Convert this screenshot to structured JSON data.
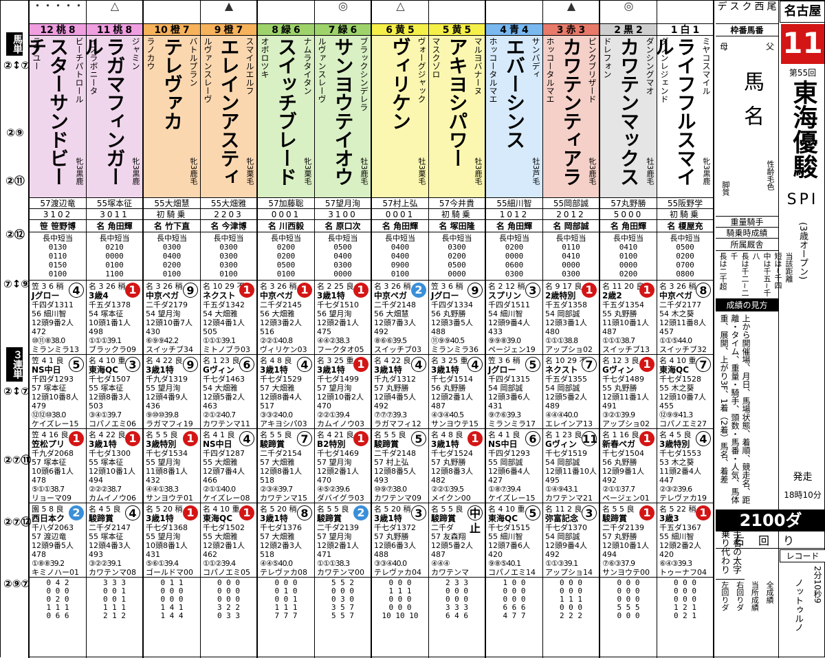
{
  "side_labels": {
    "umatan": "馬単",
    "sanrentan": "３連単",
    "combos_a": [
      "②↕⑦",
      "②⑨",
      "②⑪",
      "②⑫",
      "⑦↕⑨"
    ],
    "combos_b": [
      "②↕⑦",
      "②⑦⑪",
      "②⑦⑫",
      "②⑨⑦"
    ]
  },
  "race": {
    "venue": "名古屋",
    "number": "11",
    "edition": "第55回",
    "title": "東海優駿",
    "grade": "SPI",
    "cond": "(3歳オープン)",
    "start_label": "発走",
    "start_time": "18時10分",
    "distance": "2100ダ",
    "direction": "右回り",
    "record_label": "レコード",
    "record_time": "2分10秒9",
    "record_horse": "ノットゥルノ",
    "news": [
      "デ",
      "ス",
      "ク",
      "西",
      "尾"
    ]
  },
  "legend": {
    "rows": [
      "枠番馬番",
      "父",
      "母",
      "馬名",
      "性齢毛色",
      "脚質",
      "重量騎手",
      "騎乗時成績",
      "所属厩舎",
      "当該距離",
      "短は~千四",
      "中は千五~千八",
      "長は千二~二千",
      "長は二千超",
      "成績の見方",
      "上から開催場、月日、馬場状態、着順、競走名、距離・タイム、重量・騎手、頭数・馬番・人気、馬体重、展開、上がり3F、1着（2着）馬名、着差",
      "騎手名の太字は乗り代わり",
      "全成績",
      "当所成績",
      "右回りダ",
      "左回りダ"
    ]
  },
  "horses": [
    {
      "num": "12",
      "frame": "8",
      "color": "桃",
      "mark": "・・・・・",
      "sire": "ビーチパトロール",
      "horse": "スターサンドビーチ",
      "dam": "ラブユー",
      "sex": "牝3黒鹿",
      "jockey": "57渡辺竜",
      "rec": "3102",
      "trainer": "笹 笹野博",
      "dist": "長中短当\n0130\n0110\n0150\n0100",
      "r1": {
        "hd": "笠 3 6 稍",
        "pos": "4",
        "name": "Jグロー",
        "time": "千四ダ1311",
        "jk": "56 細川智",
        "hn": "12頭9番2人472",
        "pass": "⑩⑪⑧38.0",
        "win": "ミランミラ13"
      },
      "r2": {
        "hd": "笠 4 1 良",
        "pos": "5",
        "name": "NS中日",
        "time": "千四ダ1293",
        "jk": "57 塚本征",
        "hn": "12頭10番8人479",
        "pass": "⑫⑫⑩38.0",
        "win": "ケイズレー15"
      },
      "r3": {
        "hd": "笠 4 16 良",
        "pos": "1",
        "name": "笠松プリ",
        "time": "千九ダ2068",
        "jk": "57 塚本征",
        "hn": "10頭6番1人478",
        "pass": "⑤①①38.7",
        "win": "リョーマ09"
      },
      "r4": {
        "hd": "園 5 8 良",
        "pos": "2",
        "name": "西日本ク",
        "time": "千八ダ2063",
        "jk": "57 渡辺竜",
        "hn": "12頭9番5人478",
        "pass": "①⑧⑧39.2",
        "win": "キミノハー01"
      },
      "foot": "0 4 2\n0 0 0\n0 2 0\n1 1 1\n0 6 6"
    },
    {
      "num": "11",
      "frame": "8",
      "color": "桃",
      "mark": "△",
      "sire": "ジャミン",
      "horse": "ラガマフィンガール",
      "dam": "イスラボニータ",
      "sex": "牝3黒鹿",
      "jockey": "55塚本征",
      "rec": "3011",
      "trainer": "名 角田輝",
      "dist": "長中短当\n0210\n0000\n0100\n1100",
      "r1": {
        "hd": "名 3 26 稍",
        "pos": "1",
        "name": "3歳4",
        "time": "千五ダ1378",
        "jk": "54 塚本征",
        "hn": "10頭1番1人498",
        "pass": "①①①39.1",
        "win": "ブラックラ09"
      },
      "r2": {
        "hd": "名 4 10 重",
        "pos": "3",
        "name": "東海QC",
        "time": "千七ダ1507",
        "jk": "55 塚本征",
        "hn": "12頭8番3人503",
        "pass": "③④①39.7",
        "win": "コパノエミ06"
      },
      "r3": {
        "hd": "名 4 22 良",
        "pos": "1",
        "name": "3歳1特",
        "time": "千七ダ1300",
        "jk": "55 塚本征",
        "hn": "12頭10番1人494",
        "pass": "②②②38.7",
        "win": "カムイノウ06"
      },
      "r4": {
        "hd": "名 4 5 良",
        "pos": "4",
        "name": "駿蹄賞",
        "time": "二千ダ2147",
        "jk": "55 塚本征",
        "hn": "12頭4番3人493",
        "pass": "③②②39.1",
        "win": "カワテンマ08"
      },
      "foot": "3 3 3\n0 0 1\n0 0 1\n1 1 1\n2 1 2"
    },
    {
      "num": "10",
      "frame": "7",
      "color": "橙",
      "mark": "",
      "sire": "バトルプラン",
      "horse": "テレヴァカ",
      "dam": "ラノカウ",
      "sex": "牝3鹿毛",
      "jockey": "55大畑慧",
      "rec": "初騎乗",
      "trainer": "名 竹下直",
      "dist": "長中短当\n0300\n0400\n0200\n0100",
      "r1": {
        "hd": "名 3 26 稍",
        "pos": "9",
        "name": "中京ペガ",
        "time": "二千ダ2179",
        "jk": "54 望月洵",
        "hn": "12頭10番7人430",
        "pass": "⑥⑨⑨42.2",
        "win": "スイッチブ34"
      },
      "r2": {
        "hd": "名 4 22 良",
        "pos": "9",
        "name": "3歳1特",
        "time": "千九ダ1319",
        "jk": "55 望月洵",
        "hn": "12頭4番9人436",
        "pass": "⑨⑩⑩39.8",
        "win": "ラガマフィ19"
      },
      "r3": {
        "hd": "名 5 5 良",
        "pos": "1",
        "name": "3歳特別",
        "time": "千七ダ1534",
        "jk": "55 望月洵",
        "hn": "11頭8番1人432",
        "pass": "④④①38.3",
        "win": "サンヨウテ01"
      },
      "r4": {
        "hd": "名 5 20 稍",
        "pos": "1",
        "name": "3歳1特",
        "time": "千七ダ1368",
        "jk": "55 望月洵",
        "hn": "10頭8番1人431",
        "pass": "⑤⑥①39.4",
        "win": "ゴールドマ00"
      },
      "foot": "0 1 1\n0 0 0\n0 0 0\n1 4 1\n1 4 4"
    },
    {
      "num": "9",
      "frame": "7",
      "color": "橙",
      "mark": "▲",
      "sire": "スマイルエルフ",
      "horse": "エレインアスティ",
      "dam": "ルヴァンスレーヴ",
      "sex": "牝3栗毛",
      "jockey": "55大畑雅",
      "rec": "2203",
      "trainer": "名 今津博",
      "dist": "長中短当\n0300\n0300\n0300\n0100",
      "r1": {
        "hd": "名 10 29 不",
        "pos": "1",
        "name": "ネクスト",
        "time": "千五ダ1342",
        "jk": "54 大畑雅",
        "hn": "12頭4番1人505",
        "pass": "①①①39.1",
        "win": "ミトノブラ03"
      },
      "r2": {
        "hd": "名 1 23 良",
        "pos": "6",
        "name": "Gヴィン",
        "time": "千七ダ1463",
        "jk": "54 大畑雅",
        "hn": "12頭5番2人463",
        "pass": "②①②40.7",
        "win": "カワテンマ11"
      },
      "r3": {
        "hd": "名 4 1 良",
        "pos": "4",
        "name": "NS中日",
        "time": "千四ダ1287",
        "jk": "55 大畑雅",
        "hn": "12頭7番4人466",
        "pass": "②①①40.0",
        "win": "ケイズレー08"
      },
      "r4": {
        "hd": "名 4 10 重",
        "pos": "1",
        "name": "東海QC",
        "time": "千七ダ1502",
        "jk": "55 大畑雅",
        "hn": "12頭2番1人462",
        "pass": "①①②39.4",
        "win": "コパノエミ05"
      },
      "foot": "0 0 0\n0 0 0\n0 0 0\n3 2 2\n0 3 3"
    },
    {
      "num": "8",
      "frame": "6",
      "color": "緑",
      "mark": "",
      "sire": "ナムラタイタン",
      "horse": "スイッチブレード",
      "dam": "オボロツキ",
      "sex": "牝3栗毛",
      "jockey": "57加藤聡",
      "rec": "0001",
      "trainer": "名 川西毅",
      "dist": "長中短当\n0200\n0200\n0500\n0100",
      "r1": {
        "hd": "名 3 26 稍",
        "pos": "1",
        "name": "中京ペガ",
        "time": "二千ダ2145",
        "jk": "56 大畑雅",
        "hn": "12頭3番2人516",
        "pass": "②②①40.8",
        "win": "ヴィリケン03"
      },
      "r2": {
        "hd": "名 4 8 良",
        "pos": "4",
        "name": "3歳1特",
        "time": "千七ダ1529",
        "jk": "57 大畑雅",
        "hn": "12頭8番4人517",
        "pass": "③③②40.0",
        "win": "アキヨシパ03"
      },
      "r3": {
        "hd": "名 5 5 良",
        "pos": "7",
        "name": "駿蹄賞",
        "time": "二千ダ2154",
        "jk": "57 大畑雅",
        "hn": "12頭8番1人518",
        "pass": "②③④39.7",
        "win": "カワテンマ15"
      },
      "r4": {
        "hd": "名 5 20 稍",
        "pos": "8",
        "name": "3歳1特",
        "time": "千七ダ1376",
        "jk": "57 大畑雅",
        "hn": "12頭2番3人518",
        "pass": "④④⑤40.0",
        "win": "テレヴァカ08"
      },
      "foot": "0 0 0\n0 1 0\n0 0 1\n1 1 1\n7 7 7"
    },
    {
      "num": "7",
      "frame": "6",
      "color": "緑",
      "mark": "◎",
      "sire": "ブラックシンデレラ",
      "horse": "サンヨウテイオウ",
      "dam": "ルヴァンスレーヴ",
      "sex": "牡3鹿毛",
      "jockey": "57望月洵",
      "rec": "3100",
      "trainer": "名 原口次",
      "dist": "長中短当\n0500\n0400\n0300\n0000",
      "r1": {
        "hd": "名 2 25 良",
        "pos": "1",
        "name": "3歳1特",
        "time": "千七ダ1510",
        "jk": "56 望月洵",
        "hn": "12頭2番1人475",
        "pass": "④④②38.3",
        "win": "フークタオ05"
      },
      "r2": {
        "hd": "名 3 25 重",
        "pos": "1",
        "name": "3歳1特",
        "time": "千七ダ1499",
        "jk": "57 望月洵",
        "hn": "12頭10番2人470",
        "pass": "②②①39.4",
        "win": "カムイノウ03"
      },
      "r3": {
        "hd": "名 4 21 良",
        "pos": "1",
        "name": "B2特別",
        "time": "千七ダ1469",
        "jk": "57 望月洵",
        "hn": "12頭2番1人470",
        "pass": "④⑤②39.6",
        "win": "ダバイグラ03"
      },
      "r4": {
        "hd": "名 5 5 良",
        "pos": "2",
        "name": "駿蹄賞",
        "time": "二千ダ2139",
        "jk": "57 望月洵",
        "hn": "12頭2番1人471",
        "pass": "①①①38.3",
        "win": "カワテンマ00"
      },
      "foot": "5 5 2\n0 0 0\n0 3 0\n3 5 7\n5 5 7"
    },
    {
      "num": "6",
      "frame": "5",
      "color": "黄",
      "mark": "△",
      "sire": "ヴォーグジャック",
      "horse": "ヴィリケン",
      "dam": "",
      "sex": "牡3栗毛",
      "jockey": "57村上弘",
      "rec": "0001",
      "trainer": "名 角田輝",
      "dist": "長中短当\n0400\n0400\n0900\n0100",
      "r1": {
        "hd": "名 3 26 稍",
        "pos": "2",
        "name": "中京ペガ",
        "time": "二千ダ2148",
        "jk": "56 大畑慧",
        "hn": "12頭7番3人492",
        "pass": "⑧⑥⑥39.5",
        "win": "スイッチブ03"
      },
      "r2": {
        "hd": "名 4 22 良",
        "pos": "4",
        "name": "3歳1特",
        "time": "千九ダ1312",
        "jk": "57 丸野勝",
        "hn": "12頭4番5人492",
        "pass": "⑦⑦⑦39.3",
        "win": "ラガマフィ12"
      },
      "r3": {
        "hd": "名 5 5 良",
        "pos": "5",
        "name": "駿蹄賞",
        "time": "二千ダ2148",
        "jk": "57 村上弘",
        "hn": "12頭8番5人493",
        "pass": "⑩⑨⑦38.0",
        "win": "カワテンマ09"
      },
      "r4": {
        "hd": "名 5 20 稍",
        "pos": "3",
        "name": "3歳1特",
        "time": "千七ダ1372",
        "jk": "57 丸野勝",
        "hn": "12頭6番3人488",
        "pass": "③③④40.0",
        "win": "テレヴァカ04"
      },
      "foot": "0 0 0\n1 1 1\n0 0 0\n0 0 0\n10 10 10"
    },
    {
      "num": "5",
      "frame": "5",
      "color": "黄",
      "mark": "",
      "sire": "マルヨバナーヌ",
      "horse": "アキヨシパワー",
      "dam": "マスクゾロ",
      "sex": "牡3鹿毛",
      "jockey": "57今井貴",
      "rec": "初騎乗",
      "trainer": "名 塚田隆",
      "dist": "長中短当\n0300\n0200\n0500\n0000",
      "r1": {
        "hd": "笠 3 6 稍",
        "pos": "9",
        "name": "Jグロー",
        "time": "千四ダ1334",
        "jk": "56 丸野勝",
        "hn": "12頭3番5人488",
        "pass": "⑪⑨⑨40.5",
        "win": "ミランミラ36"
      },
      "r2": {
        "hd": "名 3 25 重",
        "pos": "4",
        "name": "3歳1特",
        "time": "千七ダ1514",
        "jk": "56 丸野勝",
        "hn": "12頭2番1人487",
        "pass": "④③④40.5",
        "win": "サンヨウテ15"
      },
      "r3": {
        "hd": "名 4 8 良",
        "pos": "1",
        "name": "3歳1特",
        "time": "千七ダ1524",
        "jk": "57 丸野勝",
        "hn": "12頭8番3人482",
        "pass": "②②①39.5",
        "win": "メイクン00"
      },
      "r4": {
        "hd": "名 5 5 良",
        "pos": "中止",
        "name": "駿蹄賞",
        "time": "二千ダ",
        "jk": "57 友森翔",
        "hn": "12頭5番2人487",
        "pass": "④④④",
        "win": "カワテンマ"
      },
      "foot": "2 3 3\n0 0 0\n0 0 0\n3 3 3\n6 4 6"
    },
    {
      "num": "4",
      "frame": "4",
      "color": "青",
      "mark": "",
      "sire": "サンバディ",
      "horse": "エバーシンス",
      "dam": "ホッコータルマエ",
      "sex": "牡3芦毛",
      "jockey": "55細川智",
      "rec": "1012",
      "trainer": "名 角田輝",
      "dist": "長中短当\n0200\n0000\n0600\n0300",
      "r1": {
        "hd": "名 2 12 稍",
        "pos": "3",
        "name": "スプリン",
        "time": "千四ダ1511",
        "jk": "54 細川智",
        "hn": "12頭9番4人433",
        "pass": "⑨⑨⑧39.0",
        "win": "ページェン19"
      },
      "r2": {
        "hd": "笠 3 6 稍",
        "pos": "5",
        "name": "Jグロー",
        "time": "千四ダ1315",
        "jk": "54 岡部誠",
        "hn": "12頭3番6人431",
        "pass": "⑨⑦⑥39.3",
        "win": "ミランミラ17"
      },
      "r3": {
        "hd": "名 4 1 良",
        "pos": "6",
        "name": "NS中日",
        "time": "千四ダ1293",
        "jk": "55 岡部誠",
        "hn": "12頭6番4人427",
        "pass": "①⑧⑦39.4",
        "win": "ケイズレー15"
      },
      "r4": {
        "hd": "名 4 10 重",
        "pos": "5",
        "name": "東海QC",
        "time": "千七ダ1515",
        "jk": "55 細川智",
        "hn": "12頭7番6人420",
        "pass": "⑨⑧⑤40.1",
        "win": "コパノエミ14"
      },
      "foot": "1 0 0\n0 0 0\n0 0 0\n6 6 6\n4 7 7"
    },
    {
      "num": "3",
      "frame": "3",
      "color": "赤",
      "mark": "▲",
      "sire": "ピンクブリザード",
      "horse": "カワテンティアラ",
      "dam": "ホッコータルマエ",
      "sex": "牝3鹿毛",
      "jockey": "55岡部誠",
      "rec": "2012",
      "trainer": "名 岡部誠",
      "dist": "長中短当\n0110\n0410\n0000\n0300",
      "r1": {
        "hd": "名 9 17 良",
        "pos": "1",
        "name": "2歳特別",
        "time": "千五ダ1358",
        "jk": "54 岡部誠",
        "hn": "12頭3番1人480",
        "pass": "①①①38.8",
        "win": "アップショ02"
      },
      "r2": {
        "hd": "名 10 29 不",
        "pos": "7",
        "name": "ネクスト",
        "time": "千五ダ1355",
        "jk": "54 岡部誠",
        "hn": "12頭5番2人489",
        "pass": "④④④40.0",
        "win": "エレインア13"
      },
      "r3": {
        "hd": "名 1 23 良",
        "pos": "11",
        "name": "Gヴィン",
        "time": "千七ダ1519",
        "jk": "54 岡部誠",
        "hn": "12頭11番10人495",
        "pass": "①④⑨43.1",
        "win": "カワテンマ21"
      },
      "r4": {
        "hd": "名 11 2 良",
        "pos": "3",
        "name": "弥富記念",
        "time": "千七ダ1370",
        "jk": "54 岡部誠",
        "hn": "12頭9番4人492",
        "pass": "①①③39.1",
        "win": "アップショ14"
      },
      "foot": "0 0 0\n0 0 0\n1 1 1\n0 0 0\n2 2 2"
    },
    {
      "num": "2",
      "frame": "2",
      "color": "黒",
      "mark": "◎",
      "sire": "ダンシングマオ",
      "horse": "カワテンマックス",
      "dam": "ドレフォン",
      "sex": "牡3鹿毛",
      "jockey": "57丸野勝",
      "rec": "5000",
      "trainer": "名 角田輝",
      "dist": "長中短当\n0410\n0100\n0000\n0200",
      "r1": {
        "hd": "名 11 20 良",
        "pos": "1",
        "name": "2歳2",
        "time": "千五ダ1354",
        "jk": "55 丸野勝",
        "hn": "11頭10番1人487",
        "pass": "①①①38.7",
        "win": "スイッチブ13"
      },
      "r2": {
        "hd": "名 12 3 良",
        "pos": "1",
        "name": "Gヴィン",
        "time": "千七ダ1489",
        "jk": "55 丸野勝",
        "hn": "12頭11番1人491",
        "pass": "③②①39.9",
        "win": "アップショ02"
      },
      "r3": {
        "hd": "名 1 16 良",
        "pos": "1",
        "name": "新春ペガ",
        "time": "千七ダ1504",
        "jk": "56 丸野勝",
        "hn": "12頭9番1人492",
        "pass": "②①①37.7",
        "win": "ページェン01"
      },
      "r4": {
        "hd": "名 5 5 良",
        "pos": "1",
        "name": "駿蹄賞",
        "time": "二千ダ2139",
        "jk": "57 丸野勝",
        "hn": "12頭10番1人494",
        "pass": "⑦⑥③37.9",
        "win": "サンヨウテ00"
      },
      "foot": "0 0 0\n0 0 0\n0 0 0\n5 5 5\n0 0 0"
    },
    {
      "num": "1",
      "frame": "1",
      "color": "白",
      "mark": "",
      "sire": "ミヤコスマイル",
      "horse": "ライフフルスマイル",
      "dam": "ダノンレジェンド",
      "sex": "牝3黒鹿",
      "jockey": "55阪野学",
      "rec": "初騎乗",
      "trainer": "名 榎屋充",
      "dist": "長中短当\n0500\n0200\n0700\n0800",
      "r1": {
        "hd": "名 3 26 稍",
        "pos": "8",
        "name": "中京ペガ",
        "time": "二千ダ2177",
        "jk": "54 木之葵",
        "hn": "12頭11番8人457",
        "pass": "①①⑤44.0",
        "win": "スイッチブ32"
      },
      "r2": {
        "hd": "名 4 10 重",
        "pos": "7",
        "name": "東海QC",
        "time": "千七ダ1528",
        "jk": "55 木之葵",
        "hn": "12頭10番7人455",
        "pass": "⑫⑨⑨41.3",
        "win": "コパノエミ27"
      },
      "r3": {
        "hd": "名 4 5 良",
        "pos": "4",
        "name": "3歳特別",
        "time": "千七ダ1553",
        "jk": "53 木之葵",
        "hn": "11頭2番4人447",
        "pass": "②③②39.6",
        "win": "テレヴァカ19"
      },
      "r4": {
        "hd": "名 5 22 稍",
        "pos": "1",
        "name": "3歳3",
        "time": "千五ダ1367",
        "jk": "55 細川智",
        "hn": "12頭2番2人420",
        "pass": "⑥④③39.3",
        "win": "トゥーナフ04"
      },
      "foot": "0 0 0\n0 0 0\n0 0 0\n1 2 1\n0 2 1"
    }
  ]
}
